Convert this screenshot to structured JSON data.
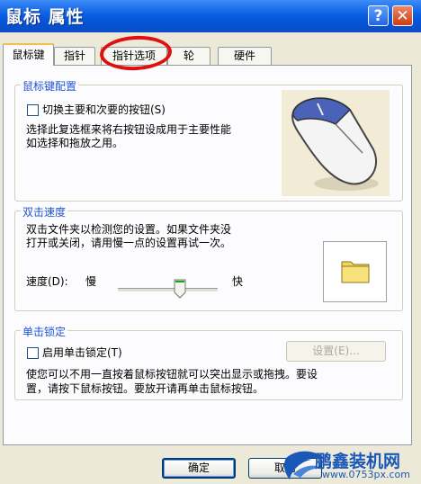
{
  "window": {
    "title": "鼠标 属性",
    "help_glyph": "?",
    "close_glyph": "✕"
  },
  "tabs": [
    {
      "label": "鼠标键",
      "active": true
    },
    {
      "label": "指针"
    },
    {
      "label": "指针选项"
    },
    {
      "label": "轮"
    },
    {
      "label": "硬件"
    }
  ],
  "button_config": {
    "group_title": "鼠标键配置",
    "switch_label": "切换主要和次要的按钮(S)",
    "switch_checked": false,
    "description_line1": "选择此复选框来将右按钮设成用于主要性能",
    "description_line2": "如选择和拖放之用。"
  },
  "double_click": {
    "group_title": "双击速度",
    "description_line1": "双击文件夹以检测您的设置。如果文件夹没",
    "description_line2": "打开或关闭，请用慢一点的设置再试一次。",
    "speed_label": "速度(D):",
    "slow_label": "慢",
    "fast_label": "快",
    "speed_value": 0.62
  },
  "click_lock": {
    "group_title": "单击锁定",
    "enable_label": "启用单击锁定(T)",
    "enable_checked": false,
    "settings_button": "设置(E)...",
    "description_line1": "使您可以不用一直按着鼠标按钮就可以突出显示或拖拽。要设",
    "description_line2": "置，请按下鼠标按钮。要放开请再单击鼠标按钮。"
  },
  "footer": {
    "ok_label": "确定",
    "cancel_label": "取消"
  },
  "watermark": {
    "brand": "鹏鑫装机网",
    "url": "www.0753px.com"
  },
  "colors": {
    "titlebar": "#0a5fe3",
    "group_title": "#1f54d4",
    "annotation": "#e11010"
  }
}
